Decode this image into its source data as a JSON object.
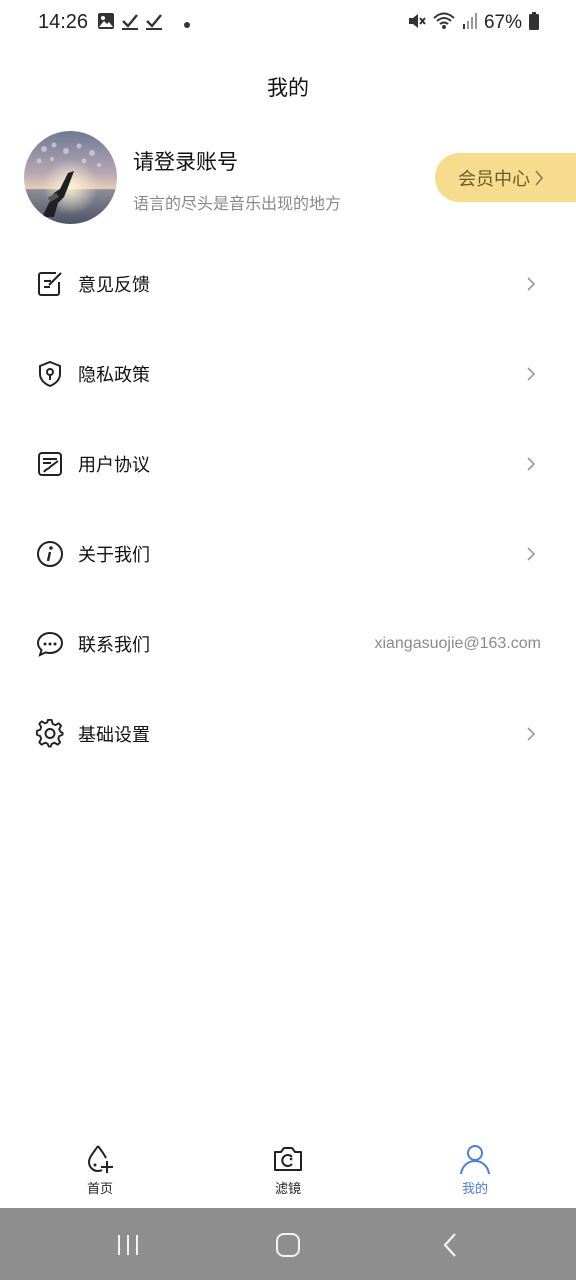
{
  "status_bar": {
    "time": "14:26",
    "battery": "67%",
    "left_icons": [
      "image-icon",
      "check-icon",
      "check-icon",
      "dot-icon"
    ],
    "right_icons": [
      "mute-icon",
      "wifi-icon",
      "signal-icon",
      "battery-icon"
    ]
  },
  "header": {
    "title": "我的"
  },
  "profile": {
    "title": "请登录账号",
    "subtitle": "语言的尽头是音乐出现的地方",
    "vip_label": "会员中心"
  },
  "menu": {
    "items": [
      {
        "label": "意见反馈",
        "icon": "feedback-icon"
      },
      {
        "label": "隐私政策",
        "icon": "privacy-shield-icon"
      },
      {
        "label": "用户协议",
        "icon": "agreement-icon"
      },
      {
        "label": "关于我们",
        "icon": "info-icon"
      },
      {
        "label": "联系我们",
        "icon": "chat-icon",
        "value": "xiangasuojie@163.com"
      },
      {
        "label": "基础设置",
        "icon": "gear-icon"
      }
    ]
  },
  "bottom_nav": {
    "items": [
      {
        "label": "首页",
        "icon": "drop-plus-icon",
        "active": false
      },
      {
        "label": "滤镜",
        "icon": "camera-icon",
        "active": false
      },
      {
        "label": "我的",
        "icon": "person-icon",
        "active": true
      }
    ],
    "active_color": "#4a7fd6"
  },
  "colors": {
    "vip_bg": "#f7dc8e",
    "system_bar": "#8e8e8e"
  }
}
